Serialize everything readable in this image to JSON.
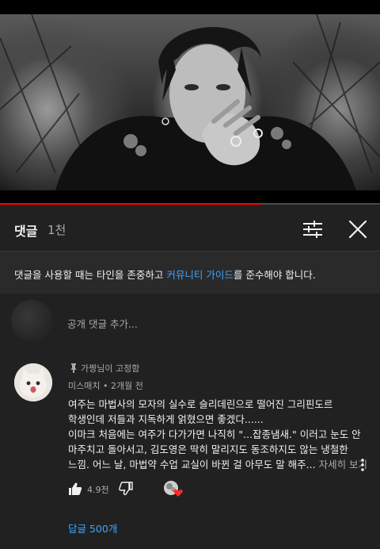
{
  "video": {
    "progress_fraction": 0.685,
    "progress_color": "#ff0000"
  },
  "comments_header": {
    "title": "댓글",
    "count": "1천",
    "sort_icon": "sort-icon",
    "close_icon": "close-icon"
  },
  "guidelines": {
    "prefix": "댓글을 사용할 때는 타인을 존중하고 ",
    "link": "커뮤니티 가이드",
    "suffix": "를 준수해야 합니다."
  },
  "add_comment": {
    "placeholder": "공개 댓글 추가..."
  },
  "comment": {
    "pinned_label": "가짱님이 고정함",
    "author": "미스매치",
    "time": "2개월 전",
    "meta_separator": " • ",
    "lines": [
      "여주는 마법사의 모자의 실수로 슬리데린으로 떨어진 그리핀도르",
      "학생인데 저들과 지독하게 얽혔으면 좋겠다......",
      "이마크 처음에는 여주가 다가가면 나직히 \"...잡종냄새.\" 이러고 눈도 안",
      "마주치고 돌아서고, 김도영은 딱히 말리지도 동조하지도 않는 냉철한",
      "느낌. 어느 날, 마법약 수업 교실이 바뀐 걸 아무도 말 해주..."
    ],
    "more_label": " 자세히 보기",
    "like_count": "4.9천",
    "replies_label": "답글 500개"
  },
  "colors": {
    "background": "#212121",
    "link": "#3ea6ff",
    "secondary_text": "#aaaaaa",
    "accent_red": "#ff0000"
  }
}
